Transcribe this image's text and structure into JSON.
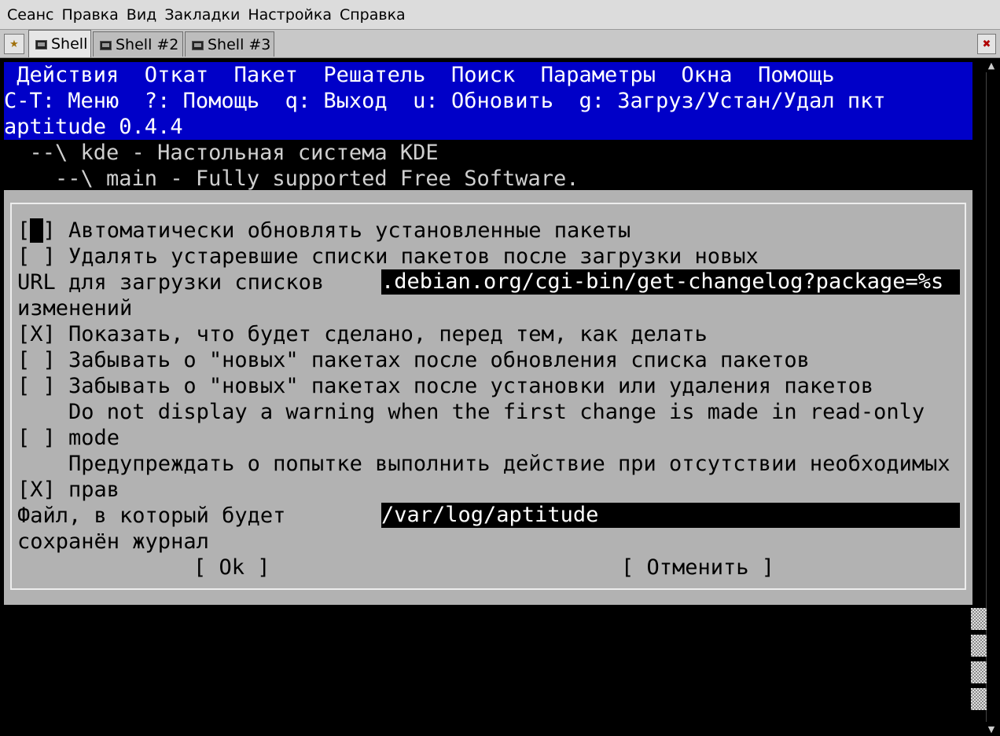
{
  "menubar": {
    "items": [
      "Сеанс",
      "Правка",
      "Вид",
      "Закладки",
      "Настройка",
      "Справка"
    ]
  },
  "tabs": [
    {
      "label": "Shell",
      "active": true
    },
    {
      "label": "Shell #2",
      "active": false
    },
    {
      "label": "Shell #3",
      "active": false
    }
  ],
  "aptitude": {
    "menu": [
      "Действия",
      "Откат",
      "Пакет",
      "Решатель",
      "Поиск",
      "Параметры",
      "Окна",
      "Помощь"
    ],
    "menu_line": " Действия  Откат  Пакет  Решатель  Поиск  Параметры  Окна  Помощь",
    "hint_line": "C-T: Меню  ?: Помощь  q: Выход  u: Обновить  g: Загруз/Устан/Удал пкт",
    "version_line": "aptitude 0.4.4",
    "tree_lines": [
      "  --\\ kde - Настольная система KDE",
      "    --\\ main - Fully supported Free Software."
    ]
  },
  "dialog": {
    "opt1_pre": "[",
    "opt1_cursor": " ",
    "opt1_post": "] Автоматически обновлять установленные пакеты",
    "opt2": "[ ] Удалять устаревшие списки пакетов после загрузки новых",
    "url_label_1": "URL для загрузки списков",
    "url_label_2": "изменений",
    "url_value": ".debian.org/cgi-bin/get-changelog?package=%s",
    "opt3": "[X] Показать, что будет сделано, перед тем, как делать",
    "opt4": "[ ] Забывать о \"новых\" пакетах после обновления списка пакетов",
    "opt5": "[ ] Забывать о \"новых\" пакетах после установки или удаления пакетов",
    "opt6_l1": "    Do not display a warning when the first change is made in read-only",
    "opt6_l2": "[ ] mode",
    "opt7_l1": "    Предупреждать о попытке выполнить действие при отсутствии необходимых",
    "opt7_l2": "[X] прав",
    "log_label_1": "Файл, в который будет",
    "log_label_2": "сохранён журнал",
    "log_value": "/var/log/aptitude",
    "ok": "[ Ok ]",
    "cancel": "[ Отменить ]"
  },
  "colors": {
    "menu_bg": "#0000c8",
    "dialog_bg": "#b2b2b2",
    "terminal_bg": "#000000"
  }
}
